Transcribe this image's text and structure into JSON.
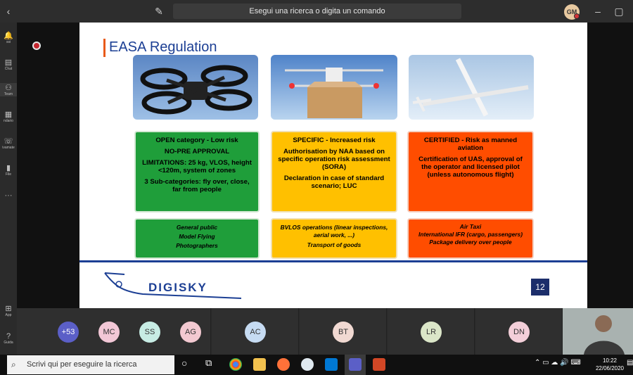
{
  "titlebar": {
    "search_placeholder": "Esegui una ricerca o digita un comando",
    "user_initials": "GM"
  },
  "leftrail": [
    {
      "label": "ssi"
    },
    {
      "label": "Chat"
    },
    {
      "label": "Team"
    },
    {
      "label": "ndario"
    },
    {
      "label": "ivamate"
    },
    {
      "label": "File"
    },
    {
      "label": "App"
    },
    {
      "label": "Guida"
    }
  ],
  "slide": {
    "title": "EASA Regulation",
    "columns": [
      {
        "color": "#1f9e3a",
        "lines": [
          "OPEN category - Low risk",
          "NO-PRE APPROVAL",
          "LIMITATIONS: 25 kg, VLOS, height <120m, system of zones",
          "3 Sub-categories: fly over, close, far from people"
        ],
        "examples": [
          "General public",
          "Model Flying",
          "Photographers"
        ]
      },
      {
        "color": "#ffc000",
        "lines": [
          "SPECIFIC - Increased risk",
          "Authorisation by NAA based on specific operation risk assessment (SORA)",
          "Declaration in case of standard scenario; LUC"
        ],
        "examples": [
          "BVLOS operations (linear inspections, aerial work, ...)",
          "Transport of goods"
        ]
      },
      {
        "color": "#ff4d00",
        "lines": [
          "CERTIFIED - Risk as manned aviation",
          "Certification of UAS, approval of the operator and licensed pilot (unless autonomous flight)"
        ],
        "examples": [
          "Air Taxi",
          "International IFR (cargo, passengers)",
          "Package delivery over people"
        ]
      }
    ],
    "logo_text": "DIGISKY",
    "page_number": "12"
  },
  "participants": [
    {
      "initials": "+53",
      "color": "#5b5fc7"
    },
    {
      "initials": "MC",
      "color": "#f2c7d6"
    },
    {
      "initials": "SS",
      "color": "#c7ece4"
    },
    {
      "initials": "AG",
      "color": "#f3c9d1"
    },
    {
      "initials": "AC",
      "color": "#c6dbf2"
    },
    {
      "initials": "BT",
      "color": "#f1d9d2"
    },
    {
      "initials": "LR",
      "color": "#dbe6c8"
    },
    {
      "initials": "DN",
      "color": "#f3cfd9"
    }
  ],
  "taskbar": {
    "search_placeholder": "Scrivi qui per eseguire la ricerca",
    "time": "10:22",
    "date": "22/06/2020"
  }
}
